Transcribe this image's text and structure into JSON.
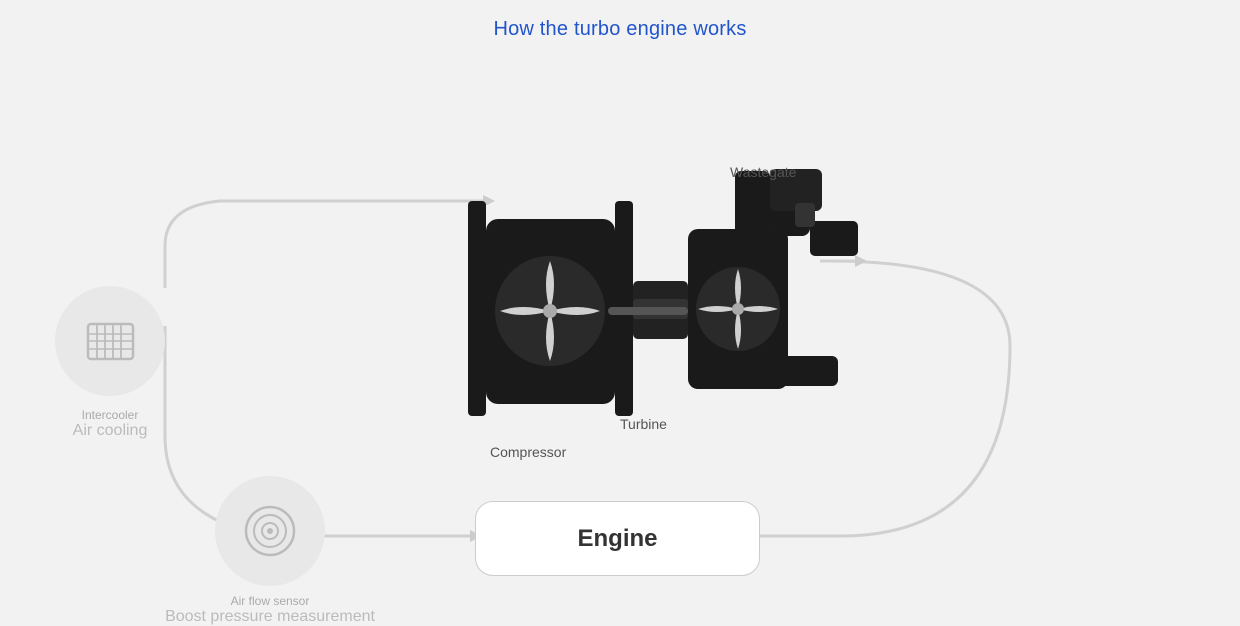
{
  "title": "How the turbo engine works",
  "components": {
    "intercooler": {
      "small_label": "Intercooler",
      "big_label": "Air cooling"
    },
    "airflow_sensor": {
      "small_label": "Air flow sensor",
      "big_label": "Boost pressure measurement"
    },
    "engine": {
      "label": "Engine"
    },
    "wastegate": {
      "label": "Wastegate"
    },
    "compressor": {
      "label": "Compressor"
    },
    "turbine": {
      "label": "Turbine"
    }
  },
  "colors": {
    "title": "#2255cc",
    "turbo_body": "#1a1a1a",
    "circle_bg": "#e8e8e8",
    "flow_line": "#d0d0d0",
    "engine_border": "#cccccc",
    "label_small": "#aaaaaa",
    "label_big": "#bbbbbb",
    "label_dark": "#555555"
  }
}
